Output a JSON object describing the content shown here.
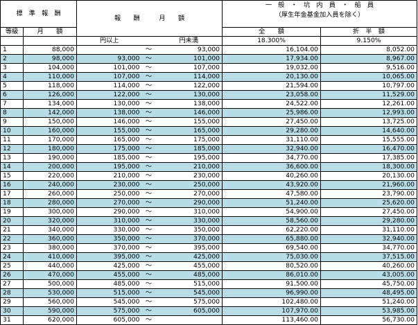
{
  "header": {
    "standard_remuneration": "標　準　報　酬",
    "grade": "等級",
    "monthly_amount": "月　　額",
    "remuneration_monthly": "報　　酬　　　月　　額",
    "yen_over": "円以上",
    "yen_under": "円未満",
    "general_line1": "一　般　・　坑　内　員　・　船　員",
    "general_line2": "（厚生年金基金加入員を除く）",
    "full_amount": "全　　額",
    "half_amount": "折　半　額",
    "full_rate": "18.300%",
    "half_rate": "9.150%",
    "tilde": "～"
  },
  "rows": [
    {
      "grade": "1",
      "monthly": "88,000",
      "from": "",
      "to": "93,000",
      "full": "16,104.00",
      "half": "8,052.00"
    },
    {
      "grade": "2",
      "monthly": "98,000",
      "from": "93,000",
      "to": "101,000",
      "full": "17,934.00",
      "half": "8,967.00"
    },
    {
      "grade": "3",
      "monthly": "104,000",
      "from": "101,000",
      "to": "107,000",
      "full": "19,032.00",
      "half": "9,516.00"
    },
    {
      "grade": "4",
      "monthly": "110,000",
      "from": "107,000",
      "to": "114,000",
      "full": "20,130.00",
      "half": "10,065.00"
    },
    {
      "grade": "5",
      "monthly": "118,000",
      "from": "114,000",
      "to": "122,000",
      "full": "21,594.00",
      "half": "10,797.00"
    },
    {
      "grade": "6",
      "monthly": "126,000",
      "from": "122,000",
      "to": "130,000",
      "full": "23,058.00",
      "half": "11,529.00"
    },
    {
      "grade": "7",
      "monthly": "134,000",
      "from": "130,000",
      "to": "138,000",
      "full": "24,522.00",
      "half": "12,261.00"
    },
    {
      "grade": "8",
      "monthly": "142,000",
      "from": "138,000",
      "to": "146,000",
      "full": "25,986.00",
      "half": "12,993.00"
    },
    {
      "grade": "9",
      "monthly": "150,000",
      "from": "146,000",
      "to": "155,000",
      "full": "27,450.00",
      "half": "13,725.00"
    },
    {
      "grade": "10",
      "monthly": "160,000",
      "from": "155,000",
      "to": "165,000",
      "full": "29,280.00",
      "half": "14,640.00"
    },
    {
      "grade": "11",
      "monthly": "170,000",
      "from": "165,000",
      "to": "175,000",
      "full": "31,110.00",
      "half": "15,555.00"
    },
    {
      "grade": "12",
      "monthly": "180,000",
      "from": "175,000",
      "to": "185,000",
      "full": "32,940.00",
      "half": "16,470.00"
    },
    {
      "grade": "13",
      "monthly": "190,000",
      "from": "185,000",
      "to": "195,000",
      "full": "34,770.00",
      "half": "17,385.00"
    },
    {
      "grade": "14",
      "monthly": "200,000",
      "from": "195,000",
      "to": "210,000",
      "full": "36,600.00",
      "half": "18,300.00"
    },
    {
      "grade": "15",
      "monthly": "220,000",
      "from": "210,000",
      "to": "230,000",
      "full": "40,260.00",
      "half": "20,130.00"
    },
    {
      "grade": "16",
      "monthly": "240,000",
      "from": "230,000",
      "to": "250,000",
      "full": "43,920.00",
      "half": "21,960.00"
    },
    {
      "grade": "17",
      "monthly": "260,000",
      "from": "250,000",
      "to": "270,000",
      "full": "47,580.00",
      "half": "23,790.00"
    },
    {
      "grade": "18",
      "monthly": "280,000",
      "from": "270,000",
      "to": "290,000",
      "full": "51,240.00",
      "half": "25,620.00"
    },
    {
      "grade": "19",
      "monthly": "300,000",
      "from": "290,000",
      "to": "310,000",
      "full": "54,900.00",
      "half": "27,450.00"
    },
    {
      "grade": "20",
      "monthly": "320,000",
      "from": "310,000",
      "to": "330,000",
      "full": "58,560.00",
      "half": "29,280.00"
    },
    {
      "grade": "21",
      "monthly": "340,000",
      "from": "330,000",
      "to": "350,000",
      "full": "62,220.00",
      "half": "31,110.00"
    },
    {
      "grade": "22",
      "monthly": "360,000",
      "from": "350,000",
      "to": "370,000",
      "full": "65,880.00",
      "half": "32,940.00"
    },
    {
      "grade": "23",
      "monthly": "380,000",
      "from": "370,000",
      "to": "395,000",
      "full": "69,540.00",
      "half": "34,770.00"
    },
    {
      "grade": "24",
      "monthly": "410,000",
      "from": "395,000",
      "to": "425,000",
      "full": "75,030.00",
      "half": "37,515.00"
    },
    {
      "grade": "25",
      "monthly": "440,000",
      "from": "425,000",
      "to": "455,000",
      "full": "80,520.00",
      "half": "40,260.00"
    },
    {
      "grade": "26",
      "monthly": "470,000",
      "from": "455,000",
      "to": "485,000",
      "full": "86,010.00",
      "half": "43,005.00"
    },
    {
      "grade": "27",
      "monthly": "500,000",
      "from": "485,000",
      "to": "515,000",
      "full": "91,500.00",
      "half": "45,750.00"
    },
    {
      "grade": "28",
      "monthly": "530,000",
      "from": "515,000",
      "to": "545,000",
      "full": "96,990.00",
      "half": "48,495.00"
    },
    {
      "grade": "29",
      "monthly": "560,000",
      "from": "545,000",
      "to": "575,000",
      "full": "102,480.00",
      "half": "51,240.00"
    },
    {
      "grade": "30",
      "monthly": "590,000",
      "from": "575,000",
      "to": "605,000",
      "full": "107,970.00",
      "half": "53,985.00"
    },
    {
      "grade": "31",
      "monthly": "620,000",
      "from": "605,000",
      "to": "",
      "full": "113,460.00",
      "half": "56,730.00"
    }
  ]
}
